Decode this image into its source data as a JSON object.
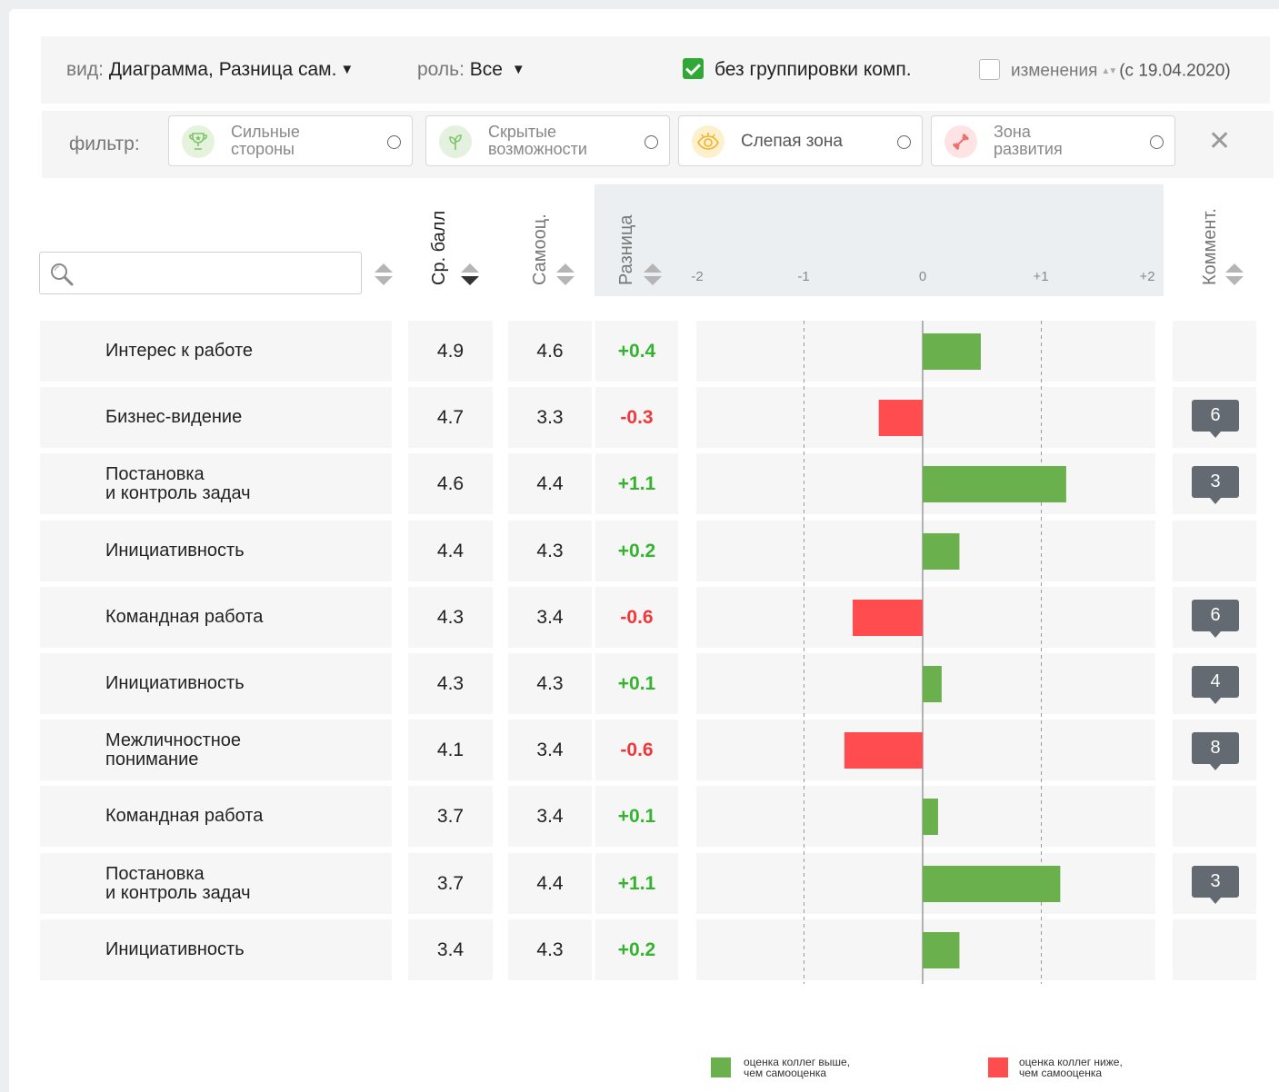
{
  "toolbar": {
    "view_label": "вид:",
    "view_value": "Диаграмма, Разница сам.",
    "role_label": "роль:",
    "role_value": "Все",
    "nogroup_label": "без группировки комп.",
    "nogroup_checked": true,
    "changes_label": "изменения",
    "changes_since": "(с 19.04.2020)",
    "changes_checked": false
  },
  "filter": {
    "label": "фильтр:",
    "chips": [
      {
        "line1": "Сильные",
        "line2": "стороны",
        "icon": "trophy-icon",
        "color": "#e6f3dc"
      },
      {
        "line1": "Скрытые",
        "line2": "возможности",
        "icon": "leaf-icon",
        "color": "#e3f1de"
      },
      {
        "line1": "Слепая зона",
        "line2": "",
        "icon": "eye-icon",
        "color": "#fdf0cf"
      },
      {
        "line1": "Зона",
        "line2": "развития",
        "icon": "dumbbell-icon",
        "color": "#fde3e3"
      }
    ]
  },
  "search": {
    "placeholder": "",
    "value": ""
  },
  "columns": {
    "avg": "Ср. балл",
    "self": "Самооц.",
    "diff": "Разница",
    "comments": "Коммент."
  },
  "chart_data": {
    "type": "bar",
    "orientation": "horizontal",
    "categories": [
      "Интерес к работе",
      "Бизнес-видение",
      "Постановка и контроль задач",
      "Инициативность",
      "Командная работа",
      "Инициативность",
      "Межличностное понимание",
      "Командная работа",
      "Постановка и контроль задач",
      "Инициативность"
    ],
    "values": [
      0.49,
      -0.37,
      1.21,
      0.31,
      -0.59,
      0.16,
      -0.66,
      0.13,
      1.16,
      0.31
    ],
    "xlim": [
      -2,
      2
    ],
    "ticks": [
      "-2",
      "-1",
      "0",
      "+1",
      "+2"
    ],
    "gridlines": [
      -1,
      1
    ],
    "colors": {
      "positive": "#6ab04c",
      "negative": "#ff4d4f"
    }
  },
  "rows": [
    {
      "name1": "Интерес к работе",
      "name2": "",
      "avg": "4.9",
      "self": "4.6",
      "diff": "+0.4",
      "sign": "pos",
      "comments": ""
    },
    {
      "name1": "Бизнес-видение",
      "name2": "",
      "avg": "4.7",
      "self": "3.3",
      "diff": "-0.3",
      "sign": "neg",
      "comments": "6"
    },
    {
      "name1": "Постановка",
      "name2": "и контроль задач",
      "avg": "4.6",
      "self": "4.4",
      "diff": "+1.1",
      "sign": "pos",
      "comments": "3"
    },
    {
      "name1": "Инициативность",
      "name2": "",
      "avg": "4.4",
      "self": "4.3",
      "diff": "+0.2",
      "sign": "pos",
      "comments": ""
    },
    {
      "name1": "Командная работа",
      "name2": "",
      "avg": "4.3",
      "self": "3.4",
      "diff": "-0.6",
      "sign": "neg",
      "comments": "6"
    },
    {
      "name1": "Инициативность",
      "name2": "",
      "avg": "4.3",
      "self": "4.3",
      "diff": "+0.1",
      "sign": "pos",
      "comments": "4"
    },
    {
      "name1": "Межличностное",
      "name2": "понимание",
      "avg": "4.1",
      "self": "3.4",
      "diff": "-0.6",
      "sign": "neg",
      "comments": "8"
    },
    {
      "name1": "Командная работа",
      "name2": "",
      "avg": "3.7",
      "self": "3.4",
      "diff": "+0.1",
      "sign": "pos",
      "comments": ""
    },
    {
      "name1": "Постановка",
      "name2": "и контроль задач",
      "avg": "3.7",
      "self": "4.4",
      "diff": "+1.1",
      "sign": "pos",
      "comments": "3"
    },
    {
      "name1": "Инициативность",
      "name2": "",
      "avg": "3.4",
      "self": "4.3",
      "diff": "+0.2",
      "sign": "pos",
      "comments": ""
    }
  ],
  "legend": {
    "positive_line1": "оценка коллег выше,",
    "positive_line2": "чем самооценка",
    "negative_line1": "оценка коллег ниже,",
    "negative_line2": "чем самооценка"
  }
}
